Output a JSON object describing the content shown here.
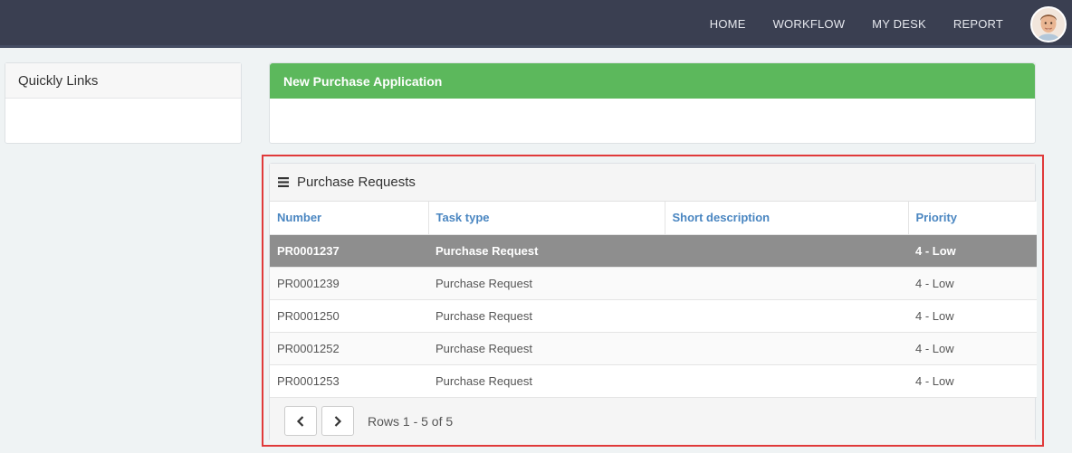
{
  "nav": {
    "items": [
      "HOME",
      "WORKFLOW",
      "MY DESK",
      "REPORT"
    ]
  },
  "quick_links": {
    "title": "Quickly Links"
  },
  "new_purchase": {
    "title": "New Purchase Application"
  },
  "purchase_requests": {
    "title": "Purchase Requests",
    "columns": [
      "Number",
      "Task type",
      "Short description",
      "Priority"
    ],
    "rows": [
      {
        "number": "PR0001237",
        "task_type": "Purchase Request",
        "short_description": "",
        "priority": "4 - Low"
      },
      {
        "number": "PR0001239",
        "task_type": "Purchase Request",
        "short_description": "",
        "priority": "4 - Low"
      },
      {
        "number": "PR0001250",
        "task_type": "Purchase Request",
        "short_description": "",
        "priority": "4 - Low"
      },
      {
        "number": "PR0001252",
        "task_type": "Purchase Request",
        "short_description": "",
        "priority": "4 - Low"
      },
      {
        "number": "PR0001253",
        "task_type": "Purchase Request",
        "short_description": "",
        "priority": "4 - Low"
      }
    ],
    "pager_info": "Rows 1 - 5 of 5"
  },
  "colors": {
    "topbar": "#3a3f51",
    "success": "#5cb85c",
    "link": "#4a86c1",
    "selected_row": "#8e8e8e",
    "highlight": "#e03a3a"
  },
  "icons": {
    "menu": "menu-icon",
    "prev": "chevron-left-icon",
    "next": "chevron-right-icon"
  }
}
